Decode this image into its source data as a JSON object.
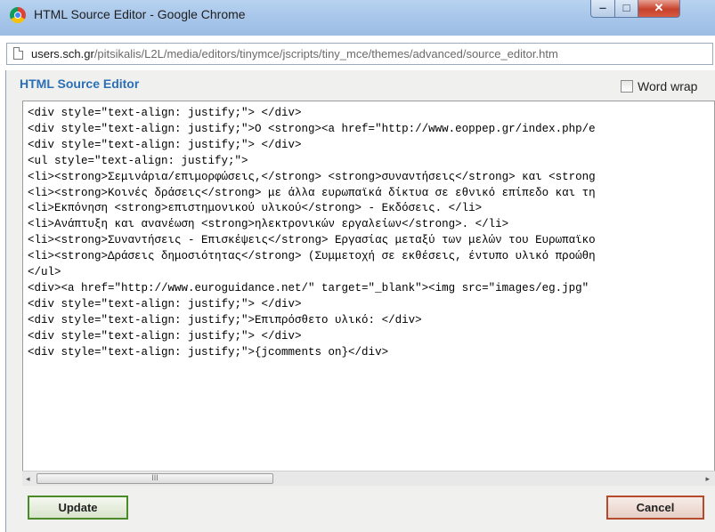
{
  "window": {
    "title": "HTML Source Editor - Google Chrome",
    "url_domain": "users.sch.gr",
    "url_path": "/pitsikalis/L2L/media/editors/tinymce/jscripts/tiny_mce/themes/advanced/source_editor.htm"
  },
  "dialog": {
    "title": "HTML Source Editor",
    "wordwrap_label": "Word wrap",
    "wordwrap_checked": false,
    "update_label": "Update",
    "cancel_label": "Cancel"
  },
  "source_lines": [
    "<div style=\"text-align: justify;\"> </div>",
    "<div style=\"text-align: justify;\">Ο <strong><a href=\"http://www.eoppep.gr/index.php/e",
    "<div style=\"text-align: justify;\"> </div>",
    "<ul style=\"text-align: justify;\">",
    "<li><strong>Σεμινάρια/επιμορφώσεις,</strong> <strong>συναντήσεις</strong> και <strong",
    "<li><strong>Κοινές δράσεις</strong> με άλλα ευρωπαϊκά δίκτυα σε εθνικό επίπεδο και τη",
    "<li>Εκπόνηση <strong>επιστημονικού υλικού</strong> - Εκδόσεις. </li>",
    "<li>Ανάπτυξη και ανανέωση <strong>ηλεκτρονικών εργαλείων</strong>. </li>",
    "<li><strong>Συναντήσεις - Επισκέψεις</strong> Εργασίας μεταξύ των μελών του Ευρωπαϊκο",
    "<li><strong>Δράσεις δημοσιότητας</strong> (Συμμετοχή σε εκθέσεις, έντυπο υλικό προώθη",
    "</ul>",
    "<div><a href=\"http://www.euroguidance.net/\" target=\"_blank\"><img src=\"images/eg.jpg\"",
    "<div style=\"text-align: justify;\"> </div>",
    "<div style=\"text-align: justify;\">Επιπρόσθετο υλικό: </div>",
    "<div style=\"text-align: justify;\"> </div>",
    "<div style=\"text-align: justify;\">{jcomments on}</div>"
  ],
  "scrollbar": {
    "left_arrow": "◂",
    "right_arrow": "▸",
    "thumb_grip": "III"
  },
  "icons": [
    "chrome-logo-icon",
    "page-icon",
    "minimize-icon",
    "maximize-icon",
    "close-icon"
  ]
}
